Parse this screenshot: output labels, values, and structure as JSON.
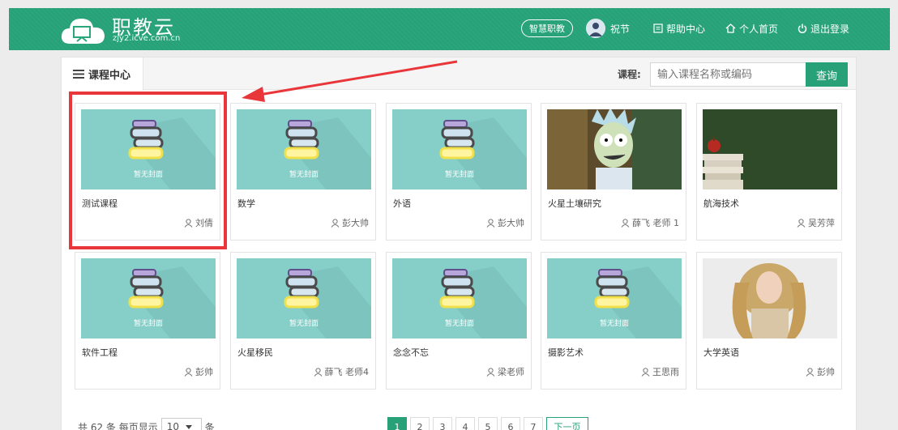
{
  "header": {
    "site_title": "职教云",
    "site_domain": "zjy2.icve.com.cn",
    "smart_btn": "智慧职教",
    "user_name": "祝节",
    "help": "帮助中心",
    "home": "个人首页",
    "logout": "退出登录",
    "accent": "#28a078"
  },
  "main": {
    "tab_label": "课程中心",
    "search_label": "课程:",
    "search_placeholder": "输入课程名称或编码",
    "search_button": "查询"
  },
  "courses": [
    {
      "title": "测试课程",
      "teacher": "刘倩",
      "cover": "default",
      "no_cover_text": "暂无封面"
    },
    {
      "title": "数学",
      "teacher": "彭大帅",
      "cover": "default",
      "no_cover_text": "暂无封面"
    },
    {
      "title": "外语",
      "teacher": "彭大帅",
      "cover": "default",
      "no_cover_text": "暂无封面"
    },
    {
      "title": "火星土壤研究",
      "teacher": "薛飞 老师 1",
      "cover": "cartoon"
    },
    {
      "title": "航海技术",
      "teacher": "吴芳萍",
      "cover": "books-apple"
    },
    {
      "title": "软件工程",
      "teacher": "彭帅",
      "cover": "default",
      "no_cover_text": "暂无封面"
    },
    {
      "title": "火星移民",
      "teacher": "薛飞 老师4",
      "cover": "default",
      "no_cover_text": "暂无封面"
    },
    {
      "title": "念念不忘",
      "teacher": "梁老师",
      "cover": "default",
      "no_cover_text": "暂无封面"
    },
    {
      "title": "摄影艺术",
      "teacher": "王思雨",
      "cover": "default",
      "no_cover_text": "暂无封面"
    },
    {
      "title": "大学英语",
      "teacher": "彭帅",
      "cover": "photo"
    }
  ],
  "pager": {
    "total_prefix": "共 62 条 每页显示",
    "per_page": "10",
    "suffix": "条",
    "pages": [
      "1",
      "2",
      "3",
      "4",
      "5",
      "6",
      "7"
    ],
    "next": "下一页"
  }
}
